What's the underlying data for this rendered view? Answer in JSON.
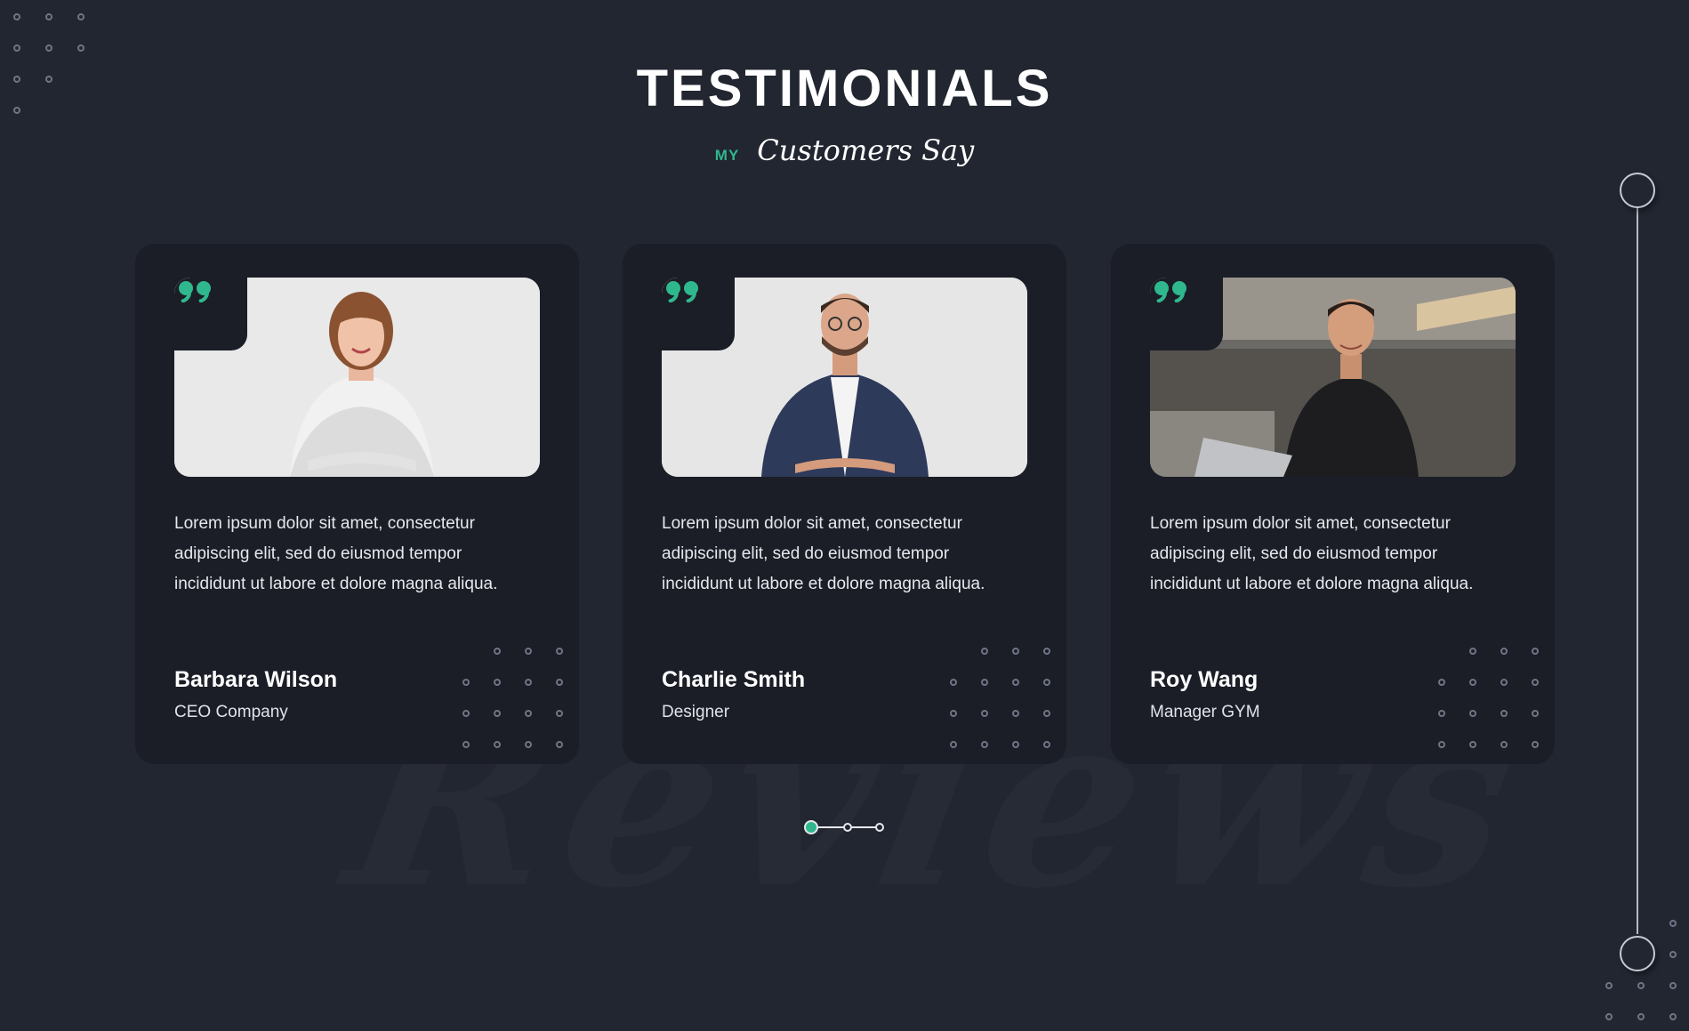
{
  "header": {
    "title": "TESTIMONIALS",
    "subtitle_prefix": "MY",
    "subtitle_script": "Customers Say"
  },
  "watermark": "Reviews",
  "colors": {
    "background": "#222631",
    "card": "#1b1e27",
    "accent": "#2fb88e",
    "text": "#ffffff"
  },
  "testimonials": [
    {
      "quote_icon": "quote-icon",
      "text": "Lorem ipsum dolor sit amet, consectetur adipiscing elit, sed do eiusmod tempor incididunt ut labore et dolore magna aliqua.",
      "name": "Barbara Wilson",
      "role": "CEO Company"
    },
    {
      "quote_icon": "quote-icon",
      "text": "Lorem ipsum dolor sit amet, consectetur adipiscing elit, sed do eiusmod tempor incididunt ut labore et dolore magna aliqua.",
      "name": "Charlie Smith",
      "role": "Designer"
    },
    {
      "quote_icon": "quote-icon",
      "text": "Lorem ipsum dolor sit amet, consectetur adipiscing elit, sed do eiusmod tempor incididunt ut labore et dolore magna aliqua.",
      "name": "Roy Wang",
      "role": "Manager GYM"
    }
  ],
  "pagination": {
    "active_page": 1,
    "total_pages": 3
  }
}
